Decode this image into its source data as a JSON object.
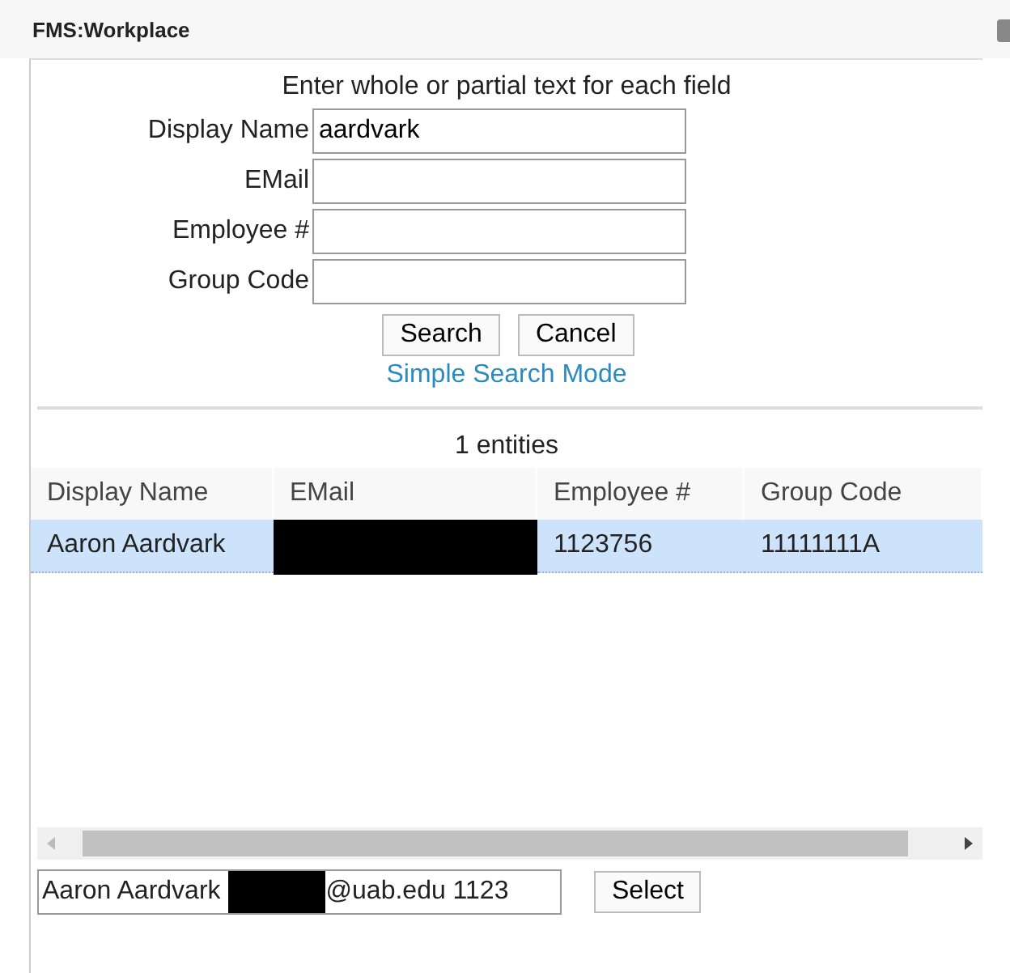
{
  "window": {
    "title": "FMS:Workplace"
  },
  "search_form": {
    "instructions": "Enter whole or partial text for each field",
    "fields": [
      {
        "label": "Display Name",
        "value": "aardvark"
      },
      {
        "label": "EMail"
      },
      {
        "label": "Employee #"
      },
      {
        "label": "Group Code"
      }
    ],
    "buttons": [
      "Search",
      "Cancel"
    ],
    "mode_link": "Simple Search Mode"
  },
  "results": {
    "count": "1 entities",
    "columns": [
      "Display Name",
      "EMail",
      "Employee #",
      "Group Code"
    ],
    "rows": [
      {
        "selected": true,
        "cells": [
          {
            "kind": "text",
            "text": "Aaron Aardvark"
          },
          {
            "kind": "redacted"
          },
          {
            "kind": "text",
            "text": "1123756"
          },
          {
            "kind": "text",
            "text": "11111111A"
          }
        ]
      }
    ]
  },
  "selection": {
    "value_start": "Aaron Aardvark",
    "value_end": "@uab.edu 1123",
    "button": "Select"
  }
}
